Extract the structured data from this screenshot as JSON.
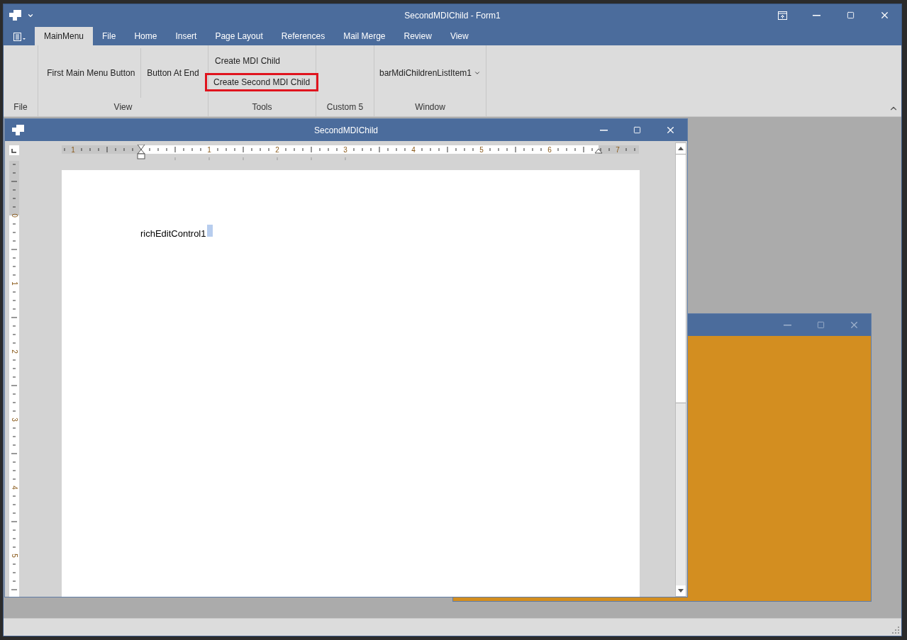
{
  "window": {
    "title": "SecondMDIChild - Form1"
  },
  "tabs": [
    {
      "label": "MainMenu",
      "selected": true
    },
    {
      "label": "File",
      "selected": false
    },
    {
      "label": "Home",
      "selected": false
    },
    {
      "label": "Insert",
      "selected": false
    },
    {
      "label": "Page Layout",
      "selected": false
    },
    {
      "label": "References",
      "selected": false
    },
    {
      "label": "Mail Merge",
      "selected": false
    },
    {
      "label": "Review",
      "selected": false
    },
    {
      "label": "View",
      "selected": false
    }
  ],
  "ribbon_groups": [
    {
      "label": "File"
    },
    {
      "label": "View",
      "items": [
        {
          "label": "First Main Menu Button",
          "kind": "large",
          "highlighted": false
        },
        {
          "label": "Button At End",
          "kind": "large",
          "highlighted": false
        }
      ]
    },
    {
      "label": "Tools",
      "items": [
        {
          "label": "Create MDI Child",
          "kind": "small",
          "highlighted": false
        },
        {
          "label": "Create Second MDI Child",
          "kind": "small",
          "highlighted": true
        }
      ]
    },
    {
      "label": "Custom 5"
    },
    {
      "label": "Window",
      "items": [
        {
          "label": "barMdiChildrenListItem1",
          "kind": "dropdown",
          "highlighted": false
        }
      ]
    }
  ],
  "child_windows": [
    {
      "kind": "document",
      "title": "SecondMDIChild",
      "active": true,
      "ruler": {
        "horizontal_labels": [
          "1",
          "1",
          "2",
          "3",
          "4",
          "5",
          "6",
          "7"
        ],
        "vertical_labels": [
          "0",
          "1",
          "2",
          "3",
          "4",
          "5"
        ]
      },
      "text": "richEditControl1"
    },
    {
      "kind": "panel",
      "active": false
    }
  ]
}
